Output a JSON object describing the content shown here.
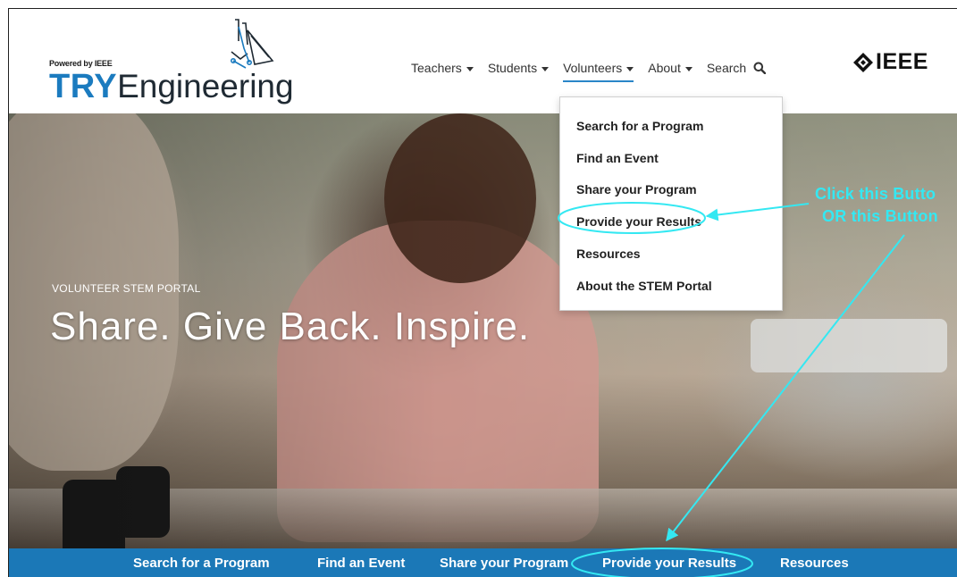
{
  "header": {
    "powered_by": "Powered by IEEE",
    "logo_try": "TRY",
    "logo_engineering": "Engineering",
    "nav": [
      {
        "label": "Teachers",
        "has_caret": true
      },
      {
        "label": "Students",
        "has_caret": true
      },
      {
        "label": "Volunteers",
        "has_caret": true,
        "active": true
      },
      {
        "label": "About",
        "has_caret": true
      },
      {
        "label": "Search",
        "icon": "search-icon"
      }
    ],
    "ieee_label": "IEEE"
  },
  "hero": {
    "eyebrow": "VOLUNTEER STEM PORTAL",
    "title": "Share. Give Back. Inspire."
  },
  "dropdown": {
    "items": [
      "Search for a Program",
      "Find an Event",
      "Share your Program",
      "Provide your Results",
      "Resources",
      "About the STEM Portal"
    ]
  },
  "bottom_bar": {
    "items": [
      "Search for a Program",
      "Find an Event",
      "Share your Program",
      "Provide your Results",
      "Resources"
    ]
  },
  "annotations": {
    "line1": "Click this Butto",
    "line2": "OR this Button",
    "color": "#34e8f2"
  },
  "colors": {
    "brand_blue": "#1b7bbf",
    "bar_blue": "#1b78b7",
    "nav_underline": "#2a86c8"
  }
}
